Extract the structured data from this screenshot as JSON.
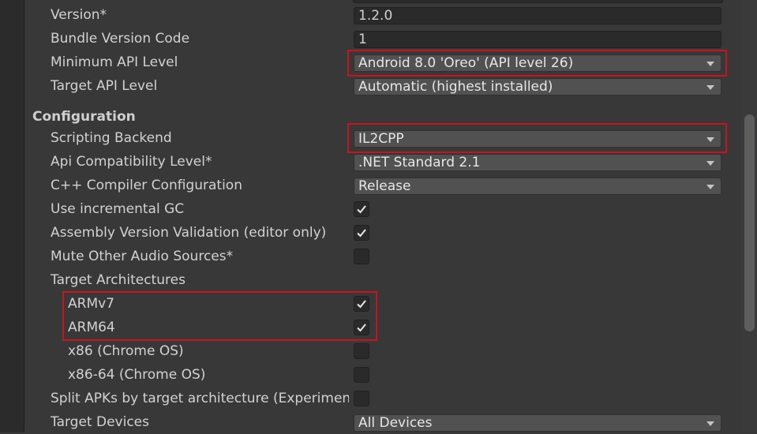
{
  "rows": {
    "version": {
      "label": "Version*",
      "value": "1.2.0"
    },
    "bundle_version_code": {
      "label": "Bundle Version Code",
      "value": "1"
    },
    "minimum_api_level": {
      "label": "Minimum API Level",
      "value": "Android 8.0 'Oreo' (API level 26)"
    },
    "target_api_level": {
      "label": "Target API Level",
      "value": "Automatic (highest installed)"
    }
  },
  "configuration": {
    "header": "Configuration",
    "scripting_backend": {
      "label": "Scripting Backend",
      "value": "IL2CPP"
    },
    "api_compatibility_level": {
      "label": "Api Compatibility Level*",
      "value": ".NET Standard 2.1"
    },
    "cpp_compiler_configuration": {
      "label": "C++ Compiler Configuration",
      "value": "Release"
    },
    "use_incremental_gc": {
      "label": "Use incremental GC",
      "checked": true
    },
    "assembly_version_validation": {
      "label": "Assembly Version Validation (editor only)",
      "checked": true
    },
    "mute_other_audio_sources": {
      "label": "Mute Other Audio Sources*",
      "checked": false
    },
    "target_architectures": {
      "label": "Target Architectures",
      "armv7": {
        "label": "ARMv7",
        "checked": true
      },
      "arm64": {
        "label": "ARM64",
        "checked": true
      },
      "x86": {
        "label": "x86 (Chrome OS)",
        "checked": false
      },
      "x86_64": {
        "label": "x86-64 (Chrome OS)",
        "checked": false
      }
    },
    "split_apks": {
      "label": "Split APKs by target architecture (Experimental)",
      "checked": false
    },
    "target_devices": {
      "label": "Target Devices",
      "value": "All Devices"
    }
  },
  "colors": {
    "panel_bg": "#383838",
    "field_bg": "#2a2a2a",
    "dropdown_bg": "#515151",
    "highlight": "#c8141e"
  }
}
